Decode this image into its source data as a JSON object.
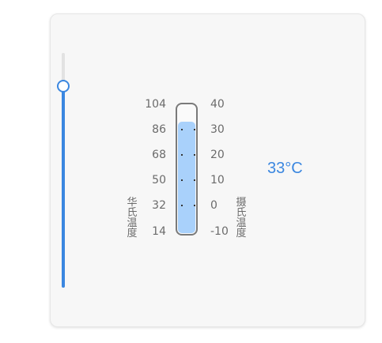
{
  "slider": {
    "value_celsius": 33,
    "min_celsius": -10,
    "max_celsius": 40
  },
  "thermometer": {
    "fahrenheit_ticks": [
      "104",
      "86",
      "68",
      "50",
      "32",
      "14"
    ],
    "celsius_ticks": [
      "40",
      "30",
      "20",
      "10",
      "0",
      "-10"
    ],
    "fahrenheit_label": "华氏温度",
    "celsius_label": "摄氏温度",
    "fill_fraction": 0.86
  },
  "readout": {
    "value": "33°C"
  },
  "colors": {
    "accent": "#3b87e0",
    "fill": "#a9d1fb",
    "track": "#e2e2e2"
  }
}
